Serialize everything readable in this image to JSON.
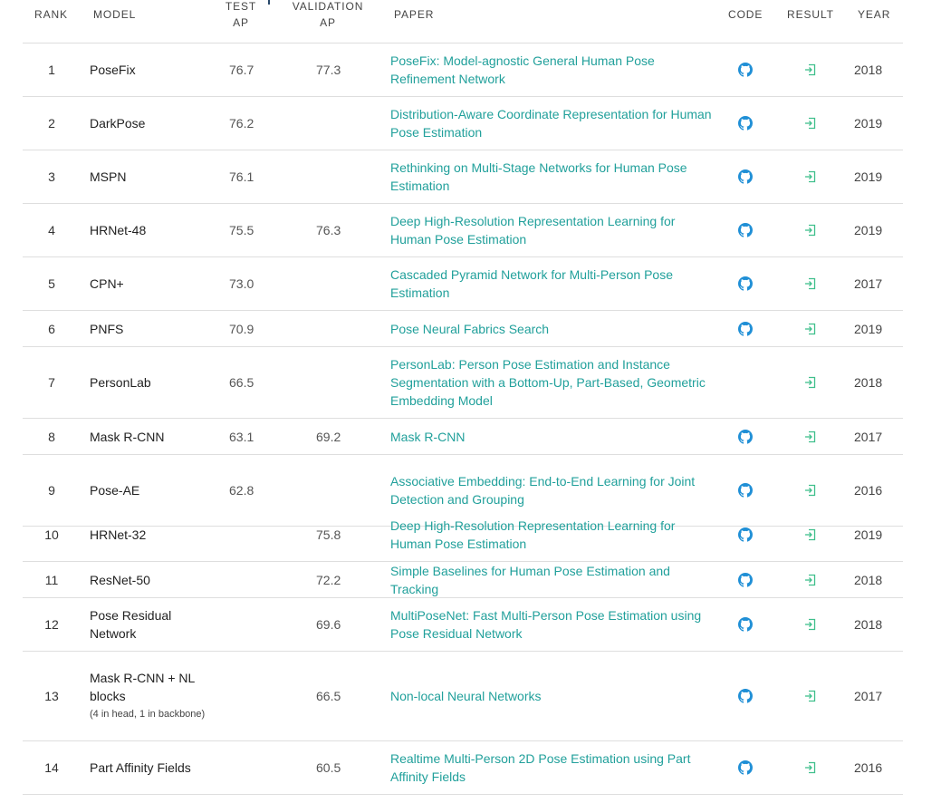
{
  "headers": {
    "rank": "RANK",
    "model": "MODEL",
    "test_ap_line1": "TEST",
    "test_ap_line2": "AP",
    "val_ap_line1": "VALIDATION",
    "val_ap_line2": "AP",
    "paper": "PAPER",
    "code": "CODE",
    "result": "RESULT",
    "year": "YEAR"
  },
  "icons": {
    "code": "github-icon",
    "result": "result-arrow-icon"
  },
  "colors": {
    "link": "#21a09b",
    "code_icon": "#1f8fd6",
    "result_icon": "#3fbf8c",
    "divider": "#dedede"
  },
  "rows": [
    {
      "rank": "1",
      "model": "PoseFix",
      "model_note": "",
      "test_ap": "76.7",
      "val_ap": "77.3",
      "paper": "PoseFix: Model-agnostic General Human Pose Refinement Network",
      "code": true,
      "result": true,
      "year": "2018"
    },
    {
      "rank": "2",
      "model": "DarkPose",
      "model_note": "",
      "test_ap": "76.2",
      "val_ap": "",
      "paper": "Distribution-Aware Coordinate Representation for Human Pose Estimation",
      "code": true,
      "result": true,
      "year": "2019"
    },
    {
      "rank": "3",
      "model": "MSPN",
      "model_note": "",
      "test_ap": "76.1",
      "val_ap": "",
      "paper": "Rethinking on Multi-Stage Networks for Human Pose Estimation",
      "code": true,
      "result": true,
      "year": "2019"
    },
    {
      "rank": "4",
      "model": "HRNet-48",
      "model_note": "",
      "test_ap": "75.5",
      "val_ap": "76.3",
      "paper": "Deep High-Resolution Representation Learning for Human Pose Estimation",
      "code": true,
      "result": true,
      "year": "2019"
    },
    {
      "rank": "5",
      "model": "CPN+",
      "model_note": "",
      "test_ap": "73.0",
      "val_ap": "",
      "paper": "Cascaded Pyramid Network for Multi-Person Pose Estimation",
      "code": true,
      "result": true,
      "year": "2017"
    },
    {
      "rank": "6",
      "model": "PNFS",
      "model_note": "",
      "test_ap": "70.9",
      "val_ap": "",
      "paper": "Pose Neural Fabrics Search",
      "code": true,
      "result": true,
      "year": "2019"
    },
    {
      "rank": "7",
      "model": "PersonLab",
      "model_note": "",
      "test_ap": "66.5",
      "val_ap": "",
      "paper": "PersonLab: Person Pose Estimation and Instance Segmentation with a Bottom-Up, Part-Based, Geometric Embedding Model",
      "code": false,
      "result": true,
      "year": "2018"
    },
    {
      "rank": "8",
      "model": "Mask R-CNN",
      "model_note": "",
      "test_ap": "63.1",
      "val_ap": "69.2",
      "paper": "Mask R-CNN",
      "code": true,
      "result": true,
      "year": "2017"
    },
    {
      "rank": "9",
      "model": "Pose-AE",
      "model_note": "",
      "test_ap": "62.8",
      "val_ap": "",
      "paper": "Associative Embedding: End-to-End Learning for Joint Detection and Grouping",
      "code": true,
      "result": true,
      "year": "2016"
    },
    {
      "rank": "10",
      "model": "HRNet-32",
      "model_note": "",
      "test_ap": "",
      "val_ap": "75.8",
      "paper": "Deep High-Resolution Representation Learning for Human Pose Estimation",
      "code": true,
      "result": true,
      "year": "2019"
    },
    {
      "rank": "11",
      "model": "ResNet-50",
      "model_note": "",
      "test_ap": "",
      "val_ap": "72.2",
      "paper": "Simple Baselines for Human Pose Estimation and Tracking",
      "code": true,
      "result": true,
      "year": "2018"
    },
    {
      "rank": "12",
      "model": "Pose Residual Network",
      "model_note": "",
      "test_ap": "",
      "val_ap": "69.6",
      "paper": "MultiPoseNet: Fast Multi-Person Pose Estimation using Pose Residual Network",
      "code": true,
      "result": true,
      "year": "2018"
    },
    {
      "rank": "13",
      "model": "Mask R-CNN + NL blocks",
      "model_note": "(4 in head, 1 in backbone)",
      "test_ap": "",
      "val_ap": "66.5",
      "paper": "Non-local Neural Networks",
      "code": true,
      "result": true,
      "year": "2017"
    },
    {
      "rank": "14",
      "model": "Part Affinity Fields",
      "model_note": "",
      "test_ap": "",
      "val_ap": "60.5",
      "paper": "Realtime Multi-Person 2D Pose Estimation using Part Affinity Fields",
      "code": true,
      "result": true,
      "year": "2016"
    }
  ]
}
